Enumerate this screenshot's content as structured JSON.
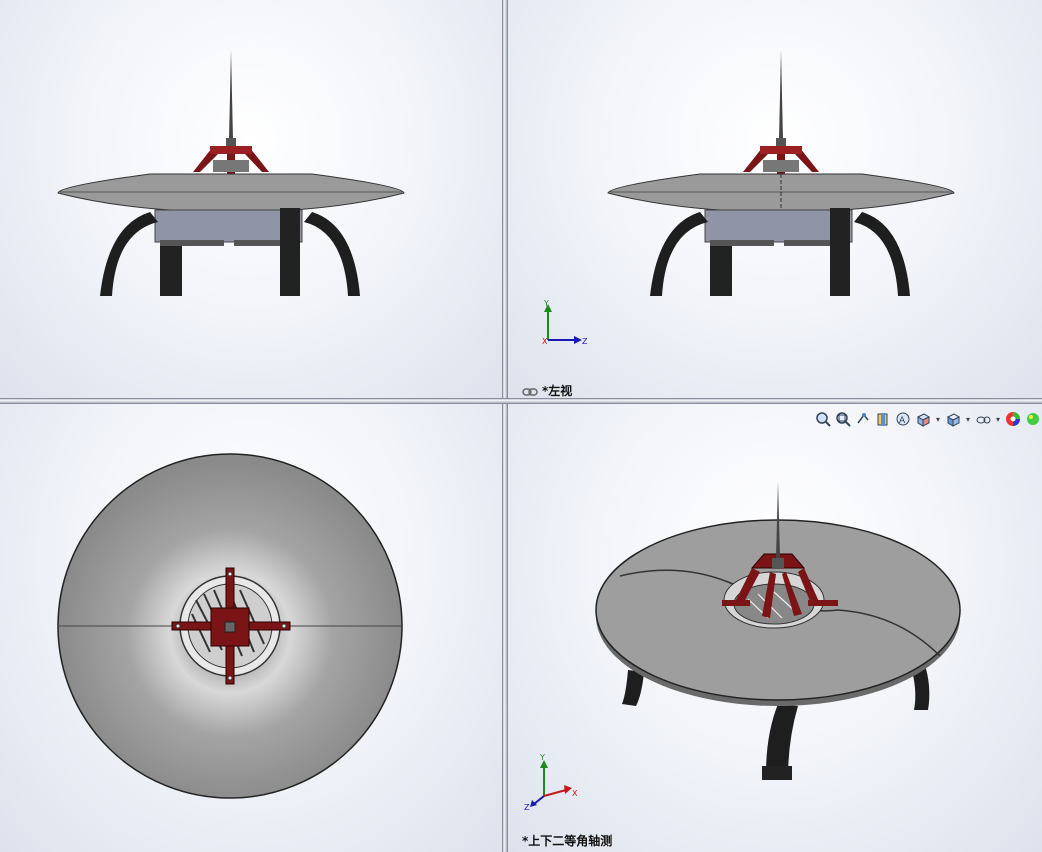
{
  "views": {
    "top_right": {
      "label": "*左视"
    },
    "bottom_right": {
      "label": "*上下二等角轴测"
    }
  },
  "triad_axes": {
    "y": "Y",
    "z": "Z",
    "x": "X"
  },
  "toolbar": {
    "icons": [
      "zoom-to-fit-icon",
      "zoom-to-area-icon",
      "previous-view-icon",
      "section-view-icon",
      "dynamic-annotation-icon",
      "view-orientation-icon",
      "display-style-icon",
      "hide-show-items-icon",
      "edit-appearance-icon",
      "apply-scene-icon"
    ]
  },
  "colors": {
    "disc": "#9a9a9a",
    "bracket": "#7a1416",
    "legs": "#222222",
    "body": "#8f94a6"
  }
}
